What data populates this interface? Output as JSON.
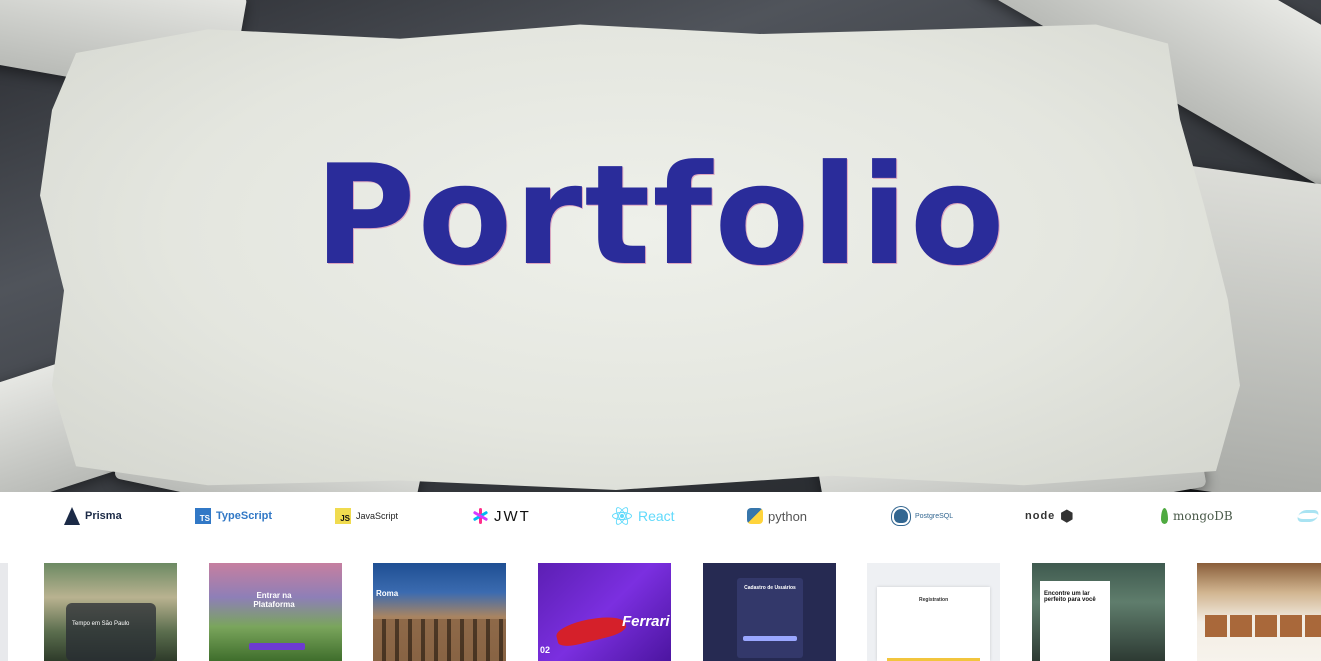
{
  "hero": {
    "title": "Portfolio"
  },
  "tech_stack": [
    {
      "name": "Prisma",
      "icon": "prisma-icon",
      "color": "#1b2a46"
    },
    {
      "name": "TypeScript",
      "icon": "typescript-icon",
      "color": "#3178c6"
    },
    {
      "name": "JavaScript",
      "icon": "javascript-icon",
      "color": "#f0db4f"
    },
    {
      "name": "JWT",
      "icon": "jwt-icon",
      "color": "#111111"
    },
    {
      "name": "React",
      "icon": "react-icon",
      "color": "#61dafb"
    },
    {
      "name": "python",
      "icon": "python-icon",
      "color": "#3776ab"
    },
    {
      "name": "PostgreSQL",
      "icon": "postgresql-icon",
      "color": "#336791"
    },
    {
      "name": "node",
      "icon": "nodejs-icon",
      "color": "#6cc24a"
    },
    {
      "name": "mongoDB",
      "icon": "mongodb-icon",
      "color": "#4faa41"
    },
    {
      "name": "",
      "icon": "tailwind-icon",
      "color": "#a9e3f2"
    }
  ],
  "projects": [
    {
      "preview": "Tempo em São Paulo"
    },
    {
      "preview": "Entrar na Plataforma"
    },
    {
      "preview": "Roma"
    },
    {
      "preview": "Ferrari",
      "number": "02"
    },
    {
      "preview": "Cadastro de Usuários"
    },
    {
      "preview": "Registration"
    },
    {
      "preview": "Encontre um lar perfeito para você"
    },
    {
      "preview": ""
    }
  ]
}
